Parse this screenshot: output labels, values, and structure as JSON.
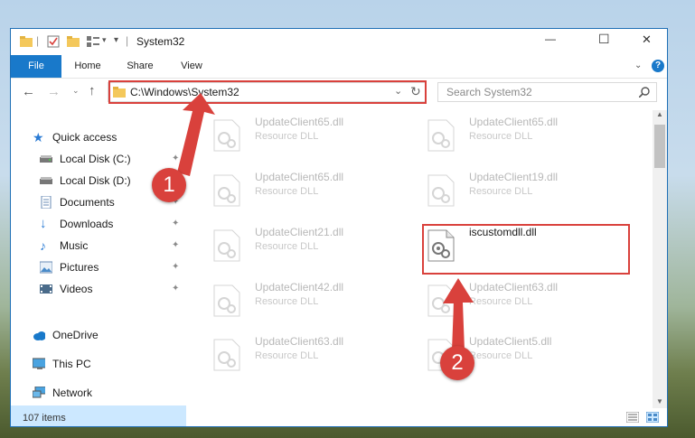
{
  "window": {
    "title": "System32",
    "controls": {
      "minimize": "—",
      "maximize": "☐",
      "close": "✕"
    }
  },
  "ribbon": {
    "tabs": [
      "File",
      "Home",
      "Share",
      "View"
    ]
  },
  "nav": {
    "address": "C:\\Windows\\System32",
    "search_placeholder": "Search System32"
  },
  "sidebar": {
    "items": [
      {
        "label": "Quick access",
        "icon": "star-icon"
      },
      {
        "label": "Local Disk (C:)",
        "icon": "drive-icon",
        "pinned": true
      },
      {
        "label": "Local Disk (D:)",
        "icon": "drive-icon",
        "pinned": true
      },
      {
        "label": "Documents",
        "icon": "documents-icon",
        "pinned": true
      },
      {
        "label": "Downloads",
        "icon": "downloads-icon",
        "pinned": true
      },
      {
        "label": "Music",
        "icon": "music-icon",
        "pinned": true
      },
      {
        "label": "Pictures",
        "icon": "pictures-icon",
        "pinned": true
      },
      {
        "label": "Videos",
        "icon": "videos-icon",
        "pinned": true
      },
      {
        "label": "OneDrive",
        "icon": "cloud-icon"
      },
      {
        "label": "This PC",
        "icon": "computer-icon",
        "selected": true
      },
      {
        "label": "Network",
        "icon": "network-icon"
      }
    ]
  },
  "files": [
    {
      "name": "UpdateClient65.dll",
      "type": "Resource DLL"
    },
    {
      "name": "UpdateClient65.dll",
      "type": "Resource DLL"
    },
    {
      "name": "UpdateClient65.dll",
      "type": "Resource DLL"
    },
    {
      "name": "UpdateClient19.dll",
      "type": "Resource DLL"
    },
    {
      "name": "UpdateClient21.dll",
      "type": "Resource DLL"
    },
    {
      "name": "iscustomdll.dll",
      "type": ""
    },
    {
      "name": "UpdateClient42.dll",
      "type": "Resource DLL"
    },
    {
      "name": "UpdateClient63.dll",
      "type": "Resource DLL"
    },
    {
      "name": "UpdateClient63.dll",
      "type": "Resource DLL"
    },
    {
      "name": "UpdateClient5.dll",
      "type": "Resource DLL"
    }
  ],
  "status": {
    "count": "107 items"
  },
  "annotations": {
    "step1": "1",
    "step2": "2"
  },
  "colors": {
    "accent": "#1979ca",
    "highlight": "#d9413c",
    "selection": "#cce8ff"
  }
}
